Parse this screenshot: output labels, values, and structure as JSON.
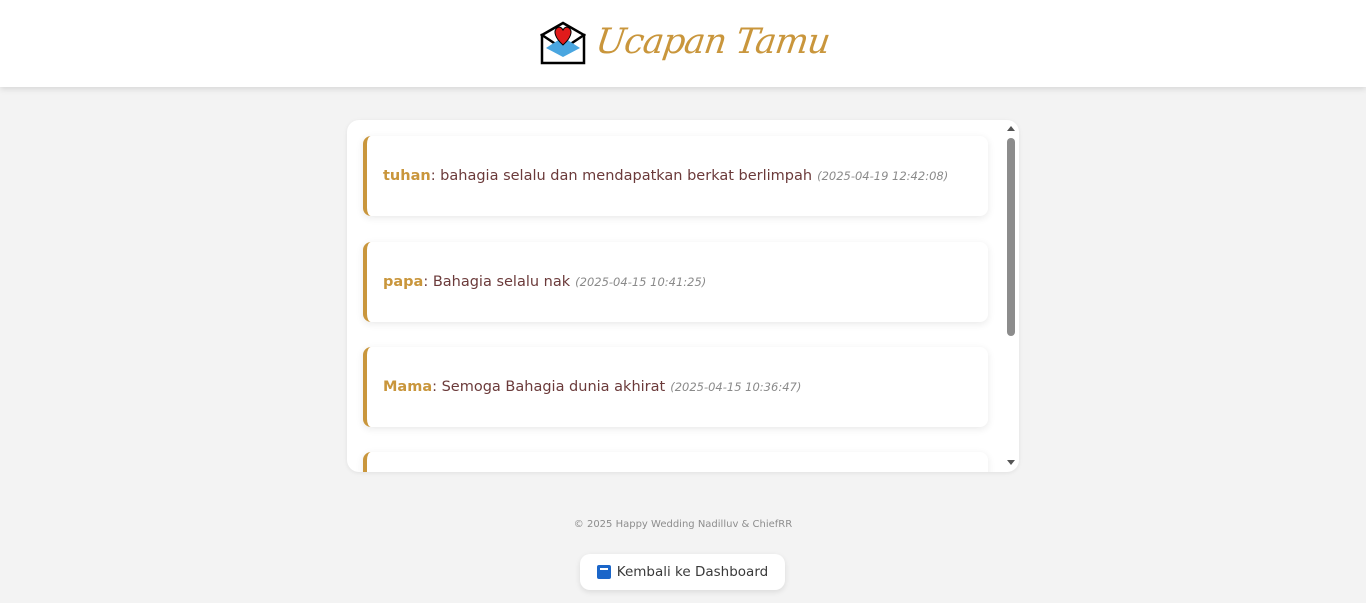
{
  "header": {
    "title": "Ucapan Tamu",
    "icon": "envelope-heart-icon"
  },
  "messages": [
    {
      "name": "tuhan",
      "text": ": bahagia selalu dan mendapatkan berkat berlimpah",
      "time": "(2025-04-19 12:42:08)"
    },
    {
      "name": "papa",
      "text": ": Bahagia selalu nak",
      "time": "(2025-04-15 10:41:25)"
    },
    {
      "name": "Mama",
      "text": ": Semoga Bahagia dunia akhirat",
      "time": "(2025-04-15 10:36:47)"
    }
  ],
  "footer": {
    "copyright": "© 2025 Happy Wedding Nadilluv & ChiefRR"
  },
  "dashboard_button": {
    "label": "Kembali ke Dashboard",
    "icon": "back-icon"
  },
  "colors": {
    "accent": "#c9963c",
    "message_text": "#6b3a3a",
    "background": "#f3f3f3"
  }
}
